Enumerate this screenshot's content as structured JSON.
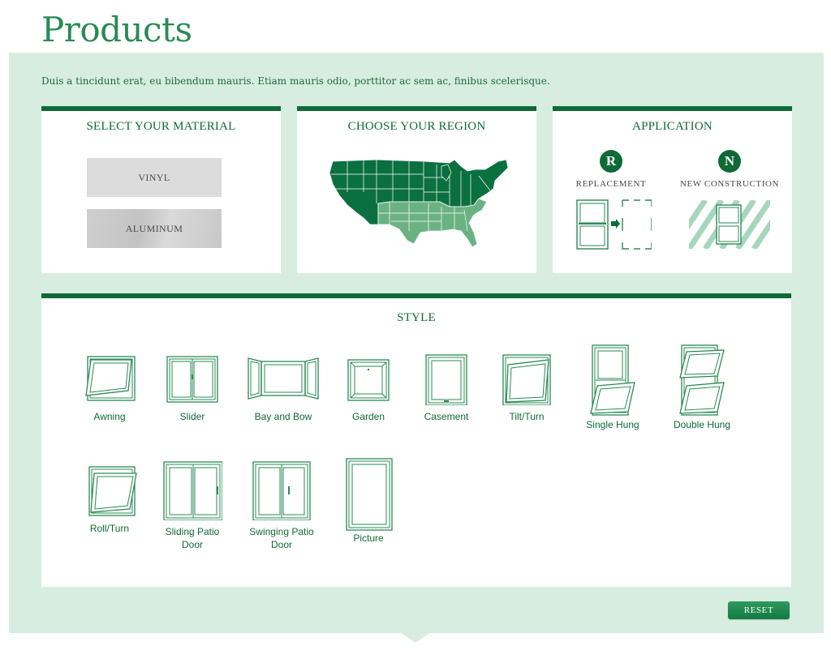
{
  "page": {
    "title": "Products",
    "intro": "Duis a tincidunt erat, eu bibendum mauris. Etiam mauris odio, porttitor ac sem ac, finibus scelerisque."
  },
  "material": {
    "title": "SELECT YOUR MATERIAL",
    "options": [
      {
        "label": "VINYL"
      },
      {
        "label": "ALUMINUM"
      }
    ]
  },
  "region": {
    "title": "CHOOSE YOUR REGION",
    "map_icon": "us-map-icon"
  },
  "application": {
    "title": "APPLICATION",
    "options": [
      {
        "badge": "R",
        "label": "REPLACEMENT",
        "icon": "replacement-window-icon"
      },
      {
        "badge": "N",
        "label": "NEW CONSTRUCTION",
        "icon": "new-construction-window-icon"
      }
    ]
  },
  "style": {
    "title": "STYLE",
    "items": [
      {
        "label": "Awning",
        "icon": "awning-window-icon"
      },
      {
        "label": "Slider",
        "icon": "slider-window-icon"
      },
      {
        "label": "Bay and Bow",
        "icon": "bay-and-bow-window-icon"
      },
      {
        "label": "Garden",
        "icon": "garden-window-icon"
      },
      {
        "label": "Casement",
        "icon": "casement-window-icon"
      },
      {
        "label": "Tilt/Turn",
        "icon": "tilt-turn-window-icon"
      },
      {
        "label": "Single Hung",
        "icon": "single-hung-window-icon"
      },
      {
        "label": "Double Hung",
        "icon": "double-hung-window-icon"
      },
      {
        "label": "Roll/Turn",
        "icon": "roll-turn-window-icon"
      },
      {
        "label": "Sliding Patio Door",
        "icon": "sliding-patio-door-icon"
      },
      {
        "label": "Swinging Patio Door",
        "icon": "swinging-patio-door-icon"
      },
      {
        "label": "Picture",
        "icon": "picture-window-icon"
      }
    ]
  },
  "actions": {
    "reset_label": "RESET"
  },
  "colors": {
    "brand_green": "#0e6a36",
    "title_green": "#2a8a55",
    "panel_bg": "#d7ede0",
    "map_dark": "#0b7040",
    "map_light": "#6bb283"
  }
}
